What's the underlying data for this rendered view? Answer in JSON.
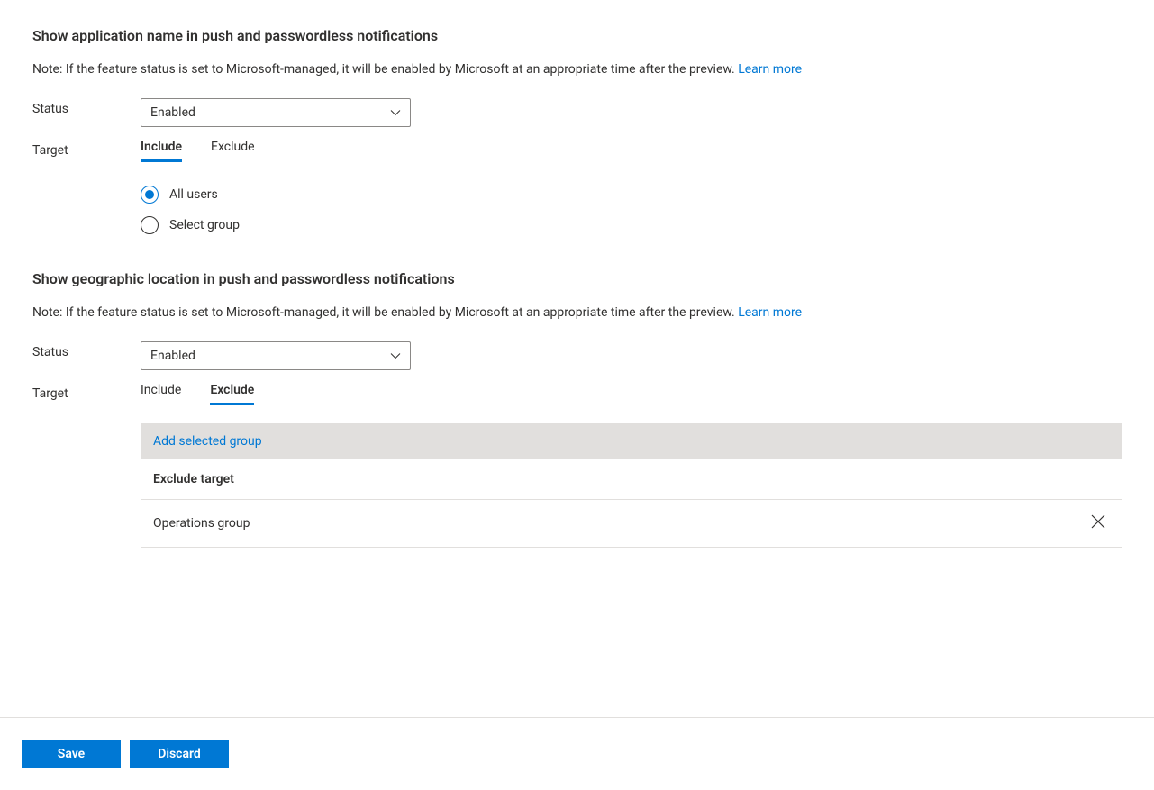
{
  "sections": [
    {
      "title": "Show application name in push and passwordless notifications",
      "note_text": "Note: If the feature status is set to Microsoft-managed, it will be enabled by Microsoft at an appropriate time after the preview. ",
      "learn_more": "Learn more",
      "status_label": "Status",
      "status_value": "Enabled",
      "target_label": "Target",
      "tabs": {
        "include": "Include",
        "exclude": "Exclude"
      },
      "active_tab": "include",
      "radio_options": {
        "all_users": "All users",
        "select_group": "Select group"
      },
      "selected_radio": "all_users"
    },
    {
      "title": "Show geographic location in push and passwordless notifications",
      "note_text": "Note: If the feature status is set to Microsoft-managed, it will be enabled by Microsoft at an appropriate time after the preview. ",
      "learn_more": "Learn more",
      "status_label": "Status",
      "status_value": "Enabled",
      "target_label": "Target",
      "tabs": {
        "include": "Include",
        "exclude": "Exclude"
      },
      "active_tab": "exclude",
      "add_group_label": "Add selected group",
      "exclude_header": "Exclude target",
      "exclude_rows": [
        "Operations group"
      ]
    }
  ],
  "footer": {
    "save": "Save",
    "discard": "Discard"
  }
}
